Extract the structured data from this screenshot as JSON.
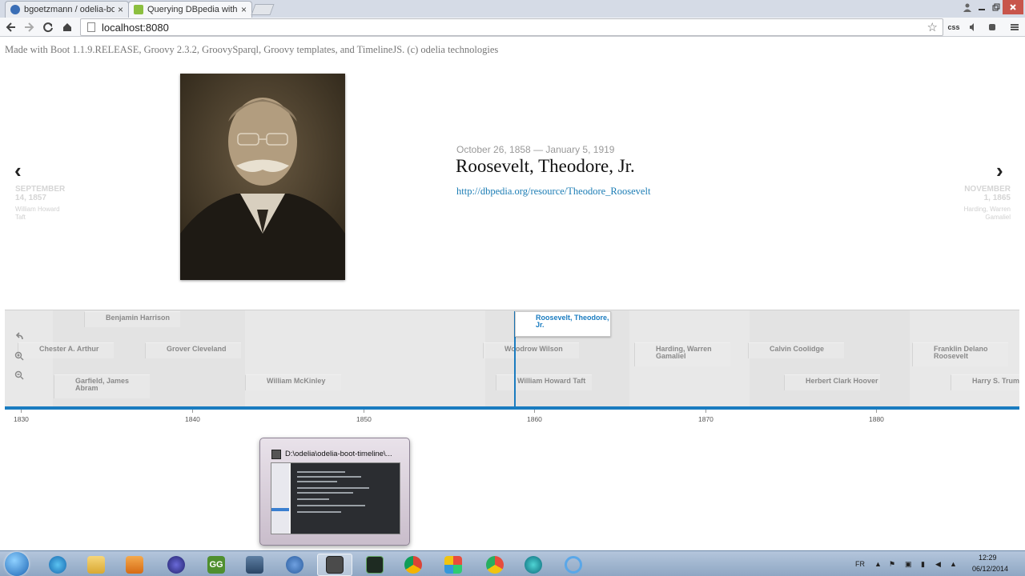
{
  "browser": {
    "tabs": [
      {
        "label": "bgoetzmann / odelia-boo",
        "active": false,
        "favicon_color": "#3b6fb6"
      },
      {
        "label": "Querying DBpedia with Sp",
        "active": true,
        "favicon_color": "#8cbf3f"
      }
    ],
    "close_glyph": "×",
    "url": "localhost:8080",
    "extensions": [
      "css"
    ]
  },
  "page": {
    "credits": "Made with Boot 1.1.9.RELEASE, Groovy 2.3.2, GroovySparql, Groovy templates, and TimelineJS. (c) odelia technologies"
  },
  "slide": {
    "date": "October 26, 1858 — January 5, 1919",
    "title": "Roosevelt, Theodore, Jr.",
    "link": "http://dbpedia.org/resource/Theodore_Roosevelt"
  },
  "nav": {
    "prev": {
      "arrow": "‹",
      "date_line1": "SEPTEMBER",
      "date_line2": "14, 1857",
      "name_line1": "William Howard",
      "name_line2": "Taft"
    },
    "next": {
      "arrow": "›",
      "date_line1": "NOVEMBER",
      "date_line2": "1, 1865",
      "name_line1": "Harding, Warren",
      "name_line2": "Gamaliel"
    }
  },
  "timeline": {
    "active": "Roosevelt, Theodore, Jr.",
    "markers": [
      "Benjamin Harrison",
      "Chester A. Arthur",
      "Grover Cleveland",
      "Garfield, James Abram",
      "William McKinley",
      "Woodrow Wilson",
      "William Howard Taft",
      "Harding, Warren Gamaliel",
      "Calvin Coolidge",
      "Herbert Clark Hoover",
      "Franklin Delano Roosevelt",
      "Harry S. Truma"
    ],
    "ticks": [
      "1830",
      "1840",
      "1850",
      "1860",
      "1870",
      "1880"
    ]
  },
  "preview": {
    "title": "D:\\odelia\\odelia-boot-timeline\\..."
  },
  "taskbar": {
    "gg_label": "GG",
    "language": "FR",
    "time": "12:29",
    "date": "06/12/2014"
  }
}
